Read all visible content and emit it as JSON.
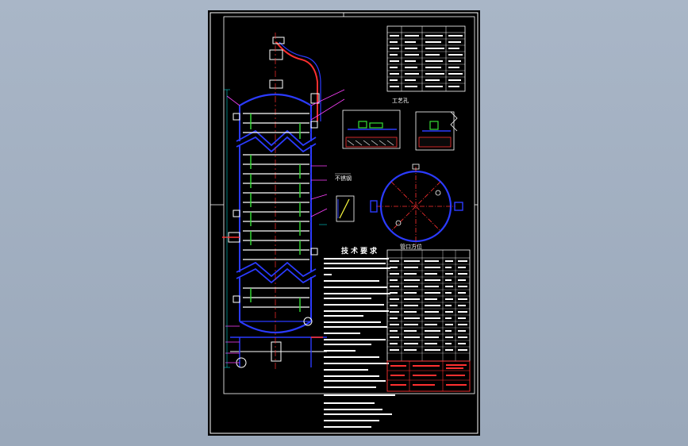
{
  "drawing": {
    "section_label_a": "工艺孔",
    "section_label_b": "不锈钢",
    "section_label_c": "管口方位",
    "requirements_title": "技术要求",
    "colors": {
      "background": "#9aa8ba",
      "sheet": "#000000",
      "frame": "#ffffff",
      "vessel": "#2b3bff",
      "tray": "#ffffff",
      "downcomer": "#35e035",
      "leader": "#ff40ff",
      "pipe": "#ff3030",
      "dimension": "#00d0d0",
      "annotation": "#ffff40"
    }
  }
}
